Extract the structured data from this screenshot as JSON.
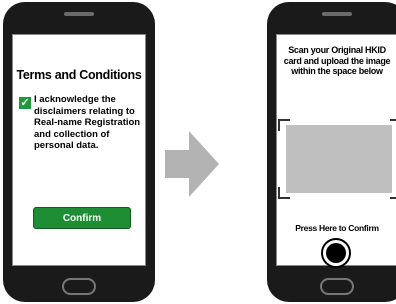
{
  "left_screen": {
    "title": "Terms and Conditions",
    "checkbox_mark": "✓",
    "acknowledgement": "I acknowledge the disclaimers relating to Real-name Registration and collection of personal data.",
    "confirm_label": "Confirm"
  },
  "right_screen": {
    "instruction": "Scan your Original HKID card and upload the image within the space below",
    "press_label": "Press Here to Confirm"
  },
  "colors": {
    "confirm_green": "#1e8e34",
    "checkbox_green": "#1e9a3a",
    "scan_frame_gray": "#bfbfbf",
    "arrow_gray": "#b3b3b3",
    "phone_body": "#1a1a1a"
  },
  "icons": {
    "arrow": "right-arrow-icon",
    "shutter": "camera-shutter-icon"
  }
}
